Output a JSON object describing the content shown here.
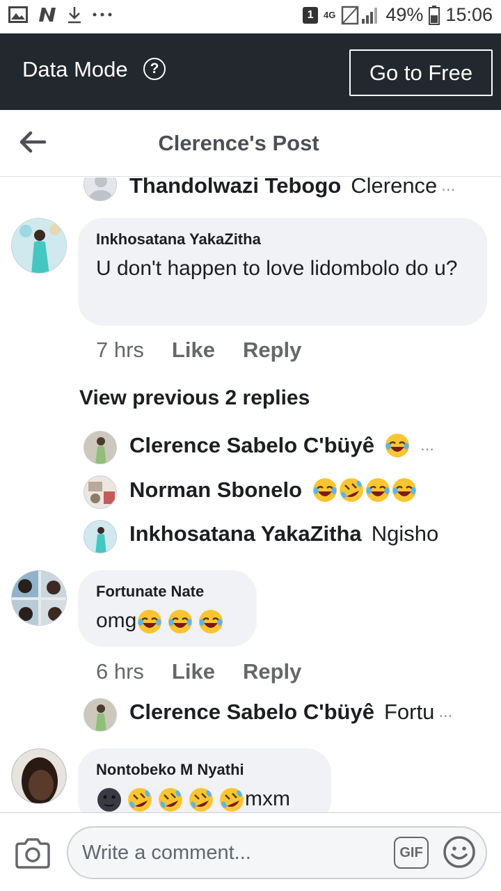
{
  "status_bar": {
    "sim_slot": "1",
    "network": "4G",
    "battery": "49%",
    "time": "15:06",
    "icons": [
      "gallery-icon",
      "n-icon",
      "download-icon",
      "more-icon",
      "signal-icon",
      "battery-icon"
    ]
  },
  "data_bar": {
    "label": "Data Mode",
    "help_icon": "?",
    "go_free_label": "Go to Free"
  },
  "header": {
    "title": "Clerence's Post",
    "back_icon": "back-arrow-icon"
  },
  "feed": {
    "top_reply": {
      "name": "Thandolwazi Tebogo",
      "text": "Clerence",
      "ellipsis": "..."
    },
    "comment1": {
      "author": "Inkhosatana YakaZitha",
      "text": "U don't happen to love lidombolo do u?",
      "time": "7 hrs",
      "like": "Like",
      "reply": "Reply"
    },
    "view_previous": "View previous 2 replies",
    "replies1": [
      {
        "name": "Clerence Sabelo C'büyê",
        "text": "",
        "ellipsis": "..."
      },
      {
        "name": "Norman Sbonelo",
        "text": "",
        "ellipsis": ""
      },
      {
        "name": "Inkhosatana YakaZitha",
        "text": "Ngisho",
        "ellipsis": ""
      }
    ],
    "comment2": {
      "author": "Fortunate Nate",
      "text": "omg",
      "time": "6 hrs",
      "like": "Like",
      "reply": "Reply"
    },
    "reply2": {
      "name": "Clerence Sabelo C'büyê",
      "text": "Fortu",
      "ellipsis": "..."
    },
    "comment3": {
      "author": "Nontobeko M Nyathi",
      "text": "mxm"
    }
  },
  "composer": {
    "placeholder": "Write a comment...",
    "gif_label": "GIF"
  },
  "colors": {
    "data_bar_bg": "#23272e",
    "bubble_bg": "#f0f2f5",
    "meta_gray": "#65676b",
    "emoji_yellow": "#fbc531"
  }
}
